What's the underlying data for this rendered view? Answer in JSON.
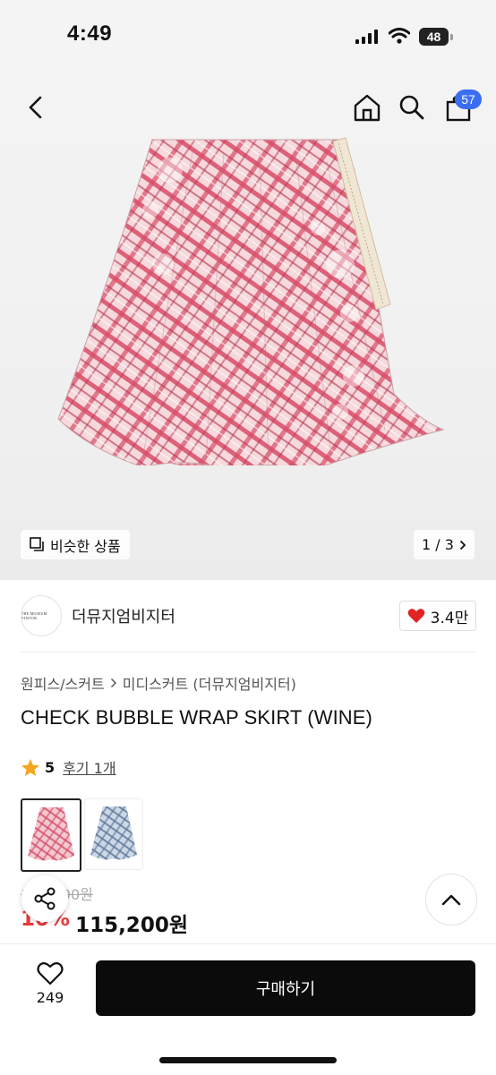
{
  "status_bar": {
    "time": "4:49",
    "battery": "48"
  },
  "nav": {
    "cart_count": "57"
  },
  "gallery": {
    "similar_label": "비슷한 상품",
    "pager": "1 / 3"
  },
  "brand": {
    "name": "더뮤지엄비지터",
    "logo_text": "THE MUSEUM VISITOR",
    "likes": "3.4만"
  },
  "breadcrumb": {
    "category": "원피스/스커트",
    "subcategory": "미디스커트 (더뮤지엄비지터)"
  },
  "product": {
    "title": "CHECK BUBBLE WRAP SKIRT (WINE)",
    "rating": "5",
    "reviews": "후기 1개",
    "original_price": "128,000원",
    "discount_rate": "10%",
    "price": "115,200원"
  },
  "bottom": {
    "wish_count": "249",
    "buy_label": "구매하기"
  },
  "colors": {
    "accent": "#3b6df3",
    "discount": "#e83a3a",
    "buy_bg": "#0b0b0b",
    "heart": "#e02424",
    "star": "#f5a623"
  }
}
